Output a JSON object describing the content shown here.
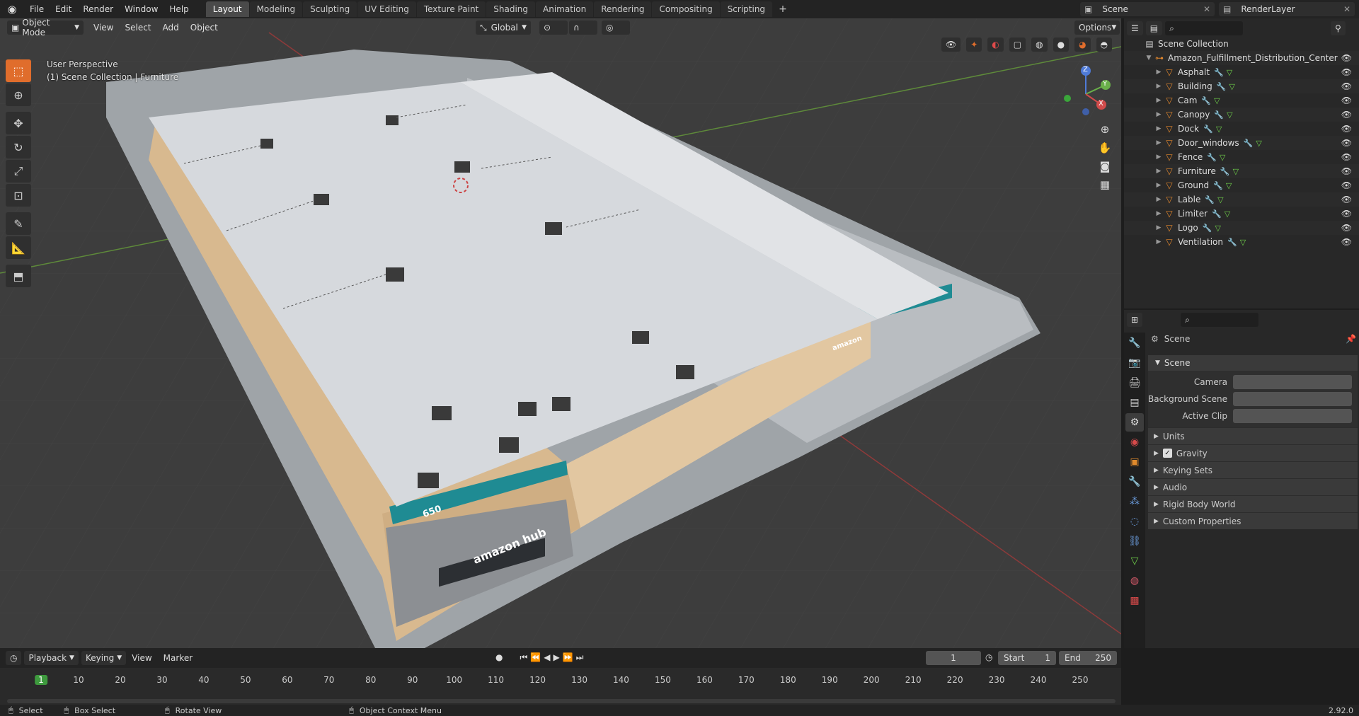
{
  "topbar": {
    "menus": [
      "File",
      "Edit",
      "Render",
      "Window",
      "Help"
    ],
    "workspaces": [
      "Layout",
      "Modeling",
      "Sculpting",
      "UV Editing",
      "Texture Paint",
      "Shading",
      "Animation",
      "Rendering",
      "Compositing",
      "Scripting"
    ],
    "active_workspace": "Layout",
    "add_tab": "+",
    "scene_name": "Scene",
    "view_layer": "RenderLayer"
  },
  "viewport": {
    "mode": "Object Mode",
    "menus": [
      "View",
      "Select",
      "Add",
      "Object"
    ],
    "transform_orientation": "Global",
    "options_label": "Options",
    "perspective_label": "User Perspective",
    "collection_label": "(1) Scene Collection | Furniture",
    "building_number": "650",
    "signage": "amazon hub",
    "signage_small": "amazon"
  },
  "gizmo": {
    "z": "Z",
    "y": "Y",
    "x": "X"
  },
  "outliner": {
    "root": "Scene Collection",
    "collection": "Amazon_Fulfillment_Distribution_Center",
    "objects": [
      "Asphalt",
      "Building",
      "Cam",
      "Canopy",
      "Dock",
      "Door_windows",
      "Fence",
      "Furniture",
      "Ground",
      "Lable",
      "Limiter",
      "Logo",
      "Ventilation"
    ]
  },
  "properties": {
    "header": "Scene",
    "panel_title": "Scene",
    "fields": [
      {
        "label": "Camera"
      },
      {
        "label": "Background Scene"
      },
      {
        "label": "Active Clip"
      }
    ],
    "subpanels": [
      "Units",
      "Gravity",
      "Keying Sets",
      "Audio",
      "Rigid Body World",
      "Custom Properties"
    ],
    "gravity_checked": true
  },
  "timeline": {
    "menus": [
      "Playback",
      "Keying",
      "View",
      "Marker"
    ],
    "current_frame": "1",
    "start_label": "Start",
    "start_value": "1",
    "end_label": "End",
    "end_value": "250",
    "ticks": [
      "1",
      "10",
      "20",
      "30",
      "40",
      "50",
      "60",
      "70",
      "80",
      "90",
      "100",
      "110",
      "120",
      "130",
      "140",
      "150",
      "160",
      "170",
      "180",
      "190",
      "200",
      "210",
      "220",
      "230",
      "240",
      "250"
    ]
  },
  "statusbar": {
    "select": "Select",
    "box_select": "Box Select",
    "rotate_view": "Rotate View",
    "context_menu": "Object Context Menu",
    "version": "2.92.0"
  }
}
